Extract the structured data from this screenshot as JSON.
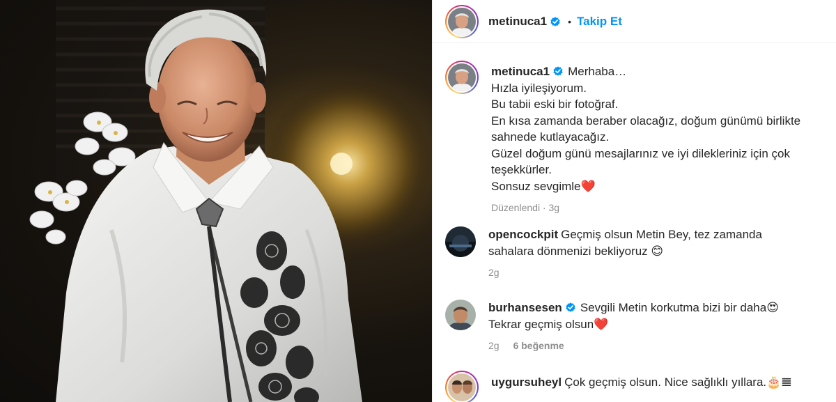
{
  "post": {
    "username": "metinuca1",
    "follow_label": "Takip Et",
    "dot": "•"
  },
  "caption": {
    "username": "metinuca1",
    "lines": [
      "Merhaba…",
      "Hızla iyileşiyorum.",
      "Bu tabii eski bir fotoğraf.",
      "En kısa zamanda beraber olacağız, doğum günümü birlikte",
      "sahnede kutlayacağız.",
      "Güzel doğum günü mesajlarınız ve iyi dilekleriniz için çok",
      "teşekkürler.",
      "Sonsuz sevgimle❤️"
    ],
    "meta": "Düzenlendi · 3g"
  },
  "comments": [
    {
      "username": "opencockpit",
      "verified": false,
      "text_line1": "Geçmiş olsun Metin Bey, tez zamanda",
      "text_line2": "sahalara dönmenizi bekliyoruz 😊",
      "time": "2g",
      "likes": ""
    },
    {
      "username": "burhansesen",
      "verified": true,
      "text_line1": "Sevgili Metin korkutma bizi bir daha😍",
      "text_line2": "Tekrar geçmiş olsun❤️",
      "time": "2g",
      "likes": "6 beğenme"
    },
    {
      "username": "uygursuheyl",
      "verified": false,
      "text_line1": "Çok geçmiş olsun. Nice sağlıklı yıllara.🎂𝌆",
      "text_line2": "",
      "time": "",
      "likes": ""
    }
  ],
  "icons": {
    "verified": "verified-badge-icon"
  },
  "colors": {
    "accent": "#0095f6",
    "verified": "#0095f6",
    "muted": "#8e8e8e",
    "text": "#262626"
  }
}
